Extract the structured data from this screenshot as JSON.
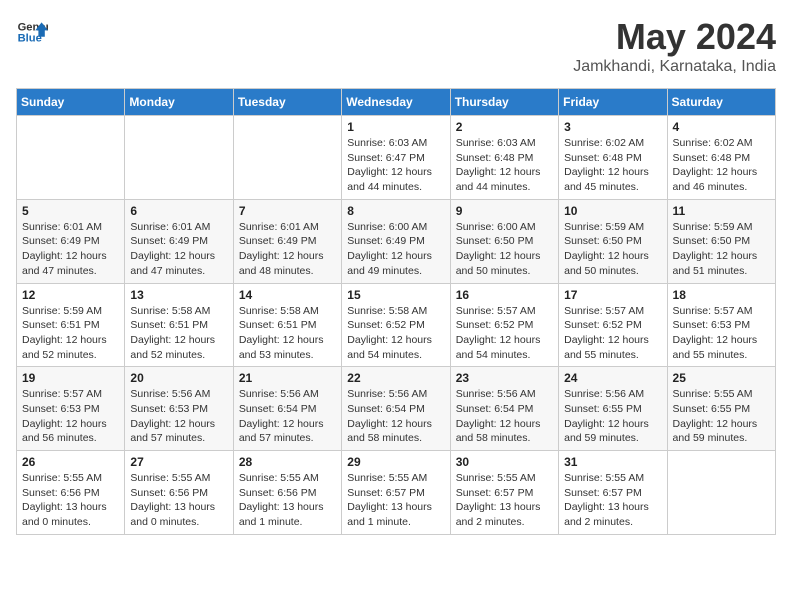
{
  "header": {
    "logo_general": "General",
    "logo_blue": "Blue",
    "month_year": "May 2024",
    "location": "Jamkhandi, Karnataka, India"
  },
  "days_of_week": [
    "Sunday",
    "Monday",
    "Tuesday",
    "Wednesday",
    "Thursday",
    "Friday",
    "Saturday"
  ],
  "weeks": [
    [
      {
        "day": "",
        "info": ""
      },
      {
        "day": "",
        "info": ""
      },
      {
        "day": "",
        "info": ""
      },
      {
        "day": "1",
        "info": "Sunrise: 6:03 AM\nSunset: 6:47 PM\nDaylight: 12 hours\nand 44 minutes."
      },
      {
        "day": "2",
        "info": "Sunrise: 6:03 AM\nSunset: 6:48 PM\nDaylight: 12 hours\nand 44 minutes."
      },
      {
        "day": "3",
        "info": "Sunrise: 6:02 AM\nSunset: 6:48 PM\nDaylight: 12 hours\nand 45 minutes."
      },
      {
        "day": "4",
        "info": "Sunrise: 6:02 AM\nSunset: 6:48 PM\nDaylight: 12 hours\nand 46 minutes."
      }
    ],
    [
      {
        "day": "5",
        "info": "Sunrise: 6:01 AM\nSunset: 6:49 PM\nDaylight: 12 hours\nand 47 minutes."
      },
      {
        "day": "6",
        "info": "Sunrise: 6:01 AM\nSunset: 6:49 PM\nDaylight: 12 hours\nand 47 minutes."
      },
      {
        "day": "7",
        "info": "Sunrise: 6:01 AM\nSunset: 6:49 PM\nDaylight: 12 hours\nand 48 minutes."
      },
      {
        "day": "8",
        "info": "Sunrise: 6:00 AM\nSunset: 6:49 PM\nDaylight: 12 hours\nand 49 minutes."
      },
      {
        "day": "9",
        "info": "Sunrise: 6:00 AM\nSunset: 6:50 PM\nDaylight: 12 hours\nand 50 minutes."
      },
      {
        "day": "10",
        "info": "Sunrise: 5:59 AM\nSunset: 6:50 PM\nDaylight: 12 hours\nand 50 minutes."
      },
      {
        "day": "11",
        "info": "Sunrise: 5:59 AM\nSunset: 6:50 PM\nDaylight: 12 hours\nand 51 minutes."
      }
    ],
    [
      {
        "day": "12",
        "info": "Sunrise: 5:59 AM\nSunset: 6:51 PM\nDaylight: 12 hours\nand 52 minutes."
      },
      {
        "day": "13",
        "info": "Sunrise: 5:58 AM\nSunset: 6:51 PM\nDaylight: 12 hours\nand 52 minutes."
      },
      {
        "day": "14",
        "info": "Sunrise: 5:58 AM\nSunset: 6:51 PM\nDaylight: 12 hours\nand 53 minutes."
      },
      {
        "day": "15",
        "info": "Sunrise: 5:58 AM\nSunset: 6:52 PM\nDaylight: 12 hours\nand 54 minutes."
      },
      {
        "day": "16",
        "info": "Sunrise: 5:57 AM\nSunset: 6:52 PM\nDaylight: 12 hours\nand 54 minutes."
      },
      {
        "day": "17",
        "info": "Sunrise: 5:57 AM\nSunset: 6:52 PM\nDaylight: 12 hours\nand 55 minutes."
      },
      {
        "day": "18",
        "info": "Sunrise: 5:57 AM\nSunset: 6:53 PM\nDaylight: 12 hours\nand 55 minutes."
      }
    ],
    [
      {
        "day": "19",
        "info": "Sunrise: 5:57 AM\nSunset: 6:53 PM\nDaylight: 12 hours\nand 56 minutes."
      },
      {
        "day": "20",
        "info": "Sunrise: 5:56 AM\nSunset: 6:53 PM\nDaylight: 12 hours\nand 57 minutes."
      },
      {
        "day": "21",
        "info": "Sunrise: 5:56 AM\nSunset: 6:54 PM\nDaylight: 12 hours\nand 57 minutes."
      },
      {
        "day": "22",
        "info": "Sunrise: 5:56 AM\nSunset: 6:54 PM\nDaylight: 12 hours\nand 58 minutes."
      },
      {
        "day": "23",
        "info": "Sunrise: 5:56 AM\nSunset: 6:54 PM\nDaylight: 12 hours\nand 58 minutes."
      },
      {
        "day": "24",
        "info": "Sunrise: 5:56 AM\nSunset: 6:55 PM\nDaylight: 12 hours\nand 59 minutes."
      },
      {
        "day": "25",
        "info": "Sunrise: 5:55 AM\nSunset: 6:55 PM\nDaylight: 12 hours\nand 59 minutes."
      }
    ],
    [
      {
        "day": "26",
        "info": "Sunrise: 5:55 AM\nSunset: 6:56 PM\nDaylight: 13 hours\nand 0 minutes."
      },
      {
        "day": "27",
        "info": "Sunrise: 5:55 AM\nSunset: 6:56 PM\nDaylight: 13 hours\nand 0 minutes."
      },
      {
        "day": "28",
        "info": "Sunrise: 5:55 AM\nSunset: 6:56 PM\nDaylight: 13 hours\nand 1 minute."
      },
      {
        "day": "29",
        "info": "Sunrise: 5:55 AM\nSunset: 6:57 PM\nDaylight: 13 hours\nand 1 minute."
      },
      {
        "day": "30",
        "info": "Sunrise: 5:55 AM\nSunset: 6:57 PM\nDaylight: 13 hours\nand 2 minutes."
      },
      {
        "day": "31",
        "info": "Sunrise: 5:55 AM\nSunset: 6:57 PM\nDaylight: 13 hours\nand 2 minutes."
      },
      {
        "day": "",
        "info": ""
      }
    ]
  ]
}
